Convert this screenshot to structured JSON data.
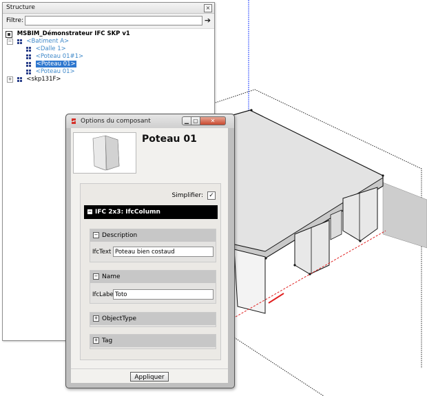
{
  "structure": {
    "title": "Structure",
    "filter_label": "Filtre:",
    "filter_value": "",
    "tree": [
      {
        "label": "MSBIM_Démonstrateur IFC SKP v1",
        "level": 0,
        "expander": "",
        "kind": "model"
      },
      {
        "label": "<Batiment A>",
        "level": 1,
        "expander": "−",
        "kind": "component"
      },
      {
        "label": "<Dalle 1>",
        "level": 2,
        "expander": "",
        "kind": "component"
      },
      {
        "label": "<Poteau 01#1>",
        "level": 2,
        "expander": "",
        "kind": "component"
      },
      {
        "label": "<Poteau 01>",
        "level": 2,
        "expander": "",
        "kind": "component",
        "selected": true
      },
      {
        "label": "<Poteau 01>",
        "level": 2,
        "expander": "",
        "kind": "component"
      },
      {
        "label": "<skp131F>",
        "level": 1,
        "expander": "+",
        "kind": "component"
      }
    ]
  },
  "dialog": {
    "title": "Options du composant",
    "component_name": "Poteau 01",
    "simplify_label": "Simplifier:",
    "simplify_checked": "✓",
    "ifc_class": "IFC 2x3: IfcColumn",
    "sections": [
      {
        "title": "Description",
        "field_label": "IfcText",
        "field_value": "Poteau bien costaud",
        "expanded": true
      },
      {
        "title": "Name",
        "field_label": "IfcLabel",
        "field_value": "Toto",
        "expanded": true
      },
      {
        "title": "ObjectType",
        "expanded": false
      },
      {
        "title": "Tag",
        "expanded": false
      }
    ],
    "apply_label": "Appliquer"
  },
  "icons": {
    "close": "close-icon",
    "go": "arrow-right-icon",
    "component": "component-icon",
    "model": "model-icon",
    "sketchup": "sketchup-logo-icon"
  },
  "colors": {
    "selection": "#2f78cf",
    "component_text": "#3e88c9",
    "ifc_bar": "#000000",
    "section_header": "#c7c7c7",
    "close_button": "#c9492f",
    "axis_red": "#e02020",
    "axis_blue": "#1f3fff",
    "axis_green": "#2e9e48"
  }
}
